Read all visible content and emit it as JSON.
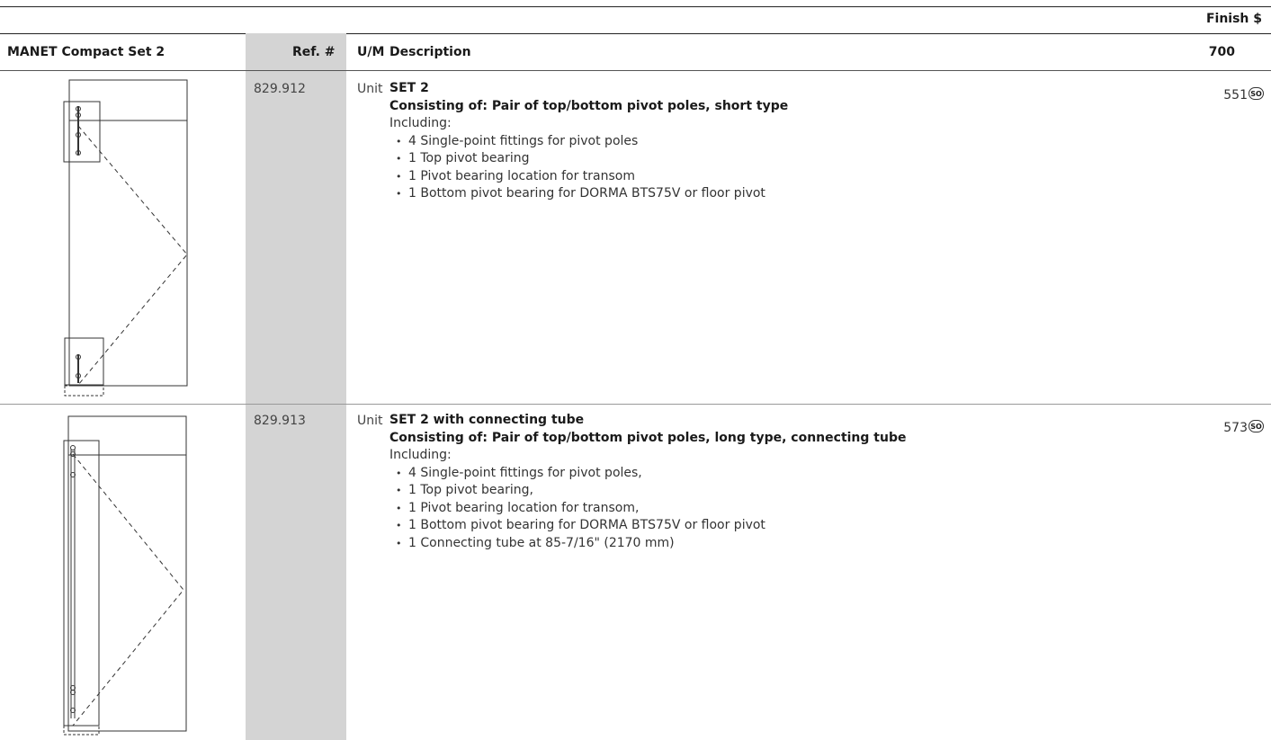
{
  "header": {
    "finish_label": "Finish $",
    "product_col": "MANET Compact Set 2",
    "ref_col": "Ref. #",
    "um_col": "U/M",
    "desc_col": "Description",
    "finish_code": "700"
  },
  "rows": [
    {
      "ref": "829.912",
      "um": "Unit",
      "title": "SET 2",
      "subtitle": "Consisting of: Pair of top/bottom pivot poles, short type",
      "including": "Including:",
      "items": [
        "4 Single-point fittings for pivot poles",
        "1 Top pivot bearing",
        "1 Pivot bearing location for transom",
        "1 Bottom pivot bearing for DORMA BTS75V or floor pivot"
      ],
      "price": "551",
      "badge": "SO"
    },
    {
      "ref": "829.913",
      "um": "Unit",
      "title": "SET 2 with connecting tube",
      "subtitle": "Consisting of: Pair of top/bottom pivot poles, long type, connecting tube",
      "including": "Including:",
      "items": [
        "4 Single-point fittings for pivot poles,",
        "1 Top pivot bearing,",
        "1 Pivot bearing location for transom,",
        "1 Bottom pivot bearing for DORMA BTS75V or floor pivot",
        "1 Connecting tube at 85-7/16\" (2170 mm)"
      ],
      "price": "573",
      "badge": "SO"
    }
  ]
}
